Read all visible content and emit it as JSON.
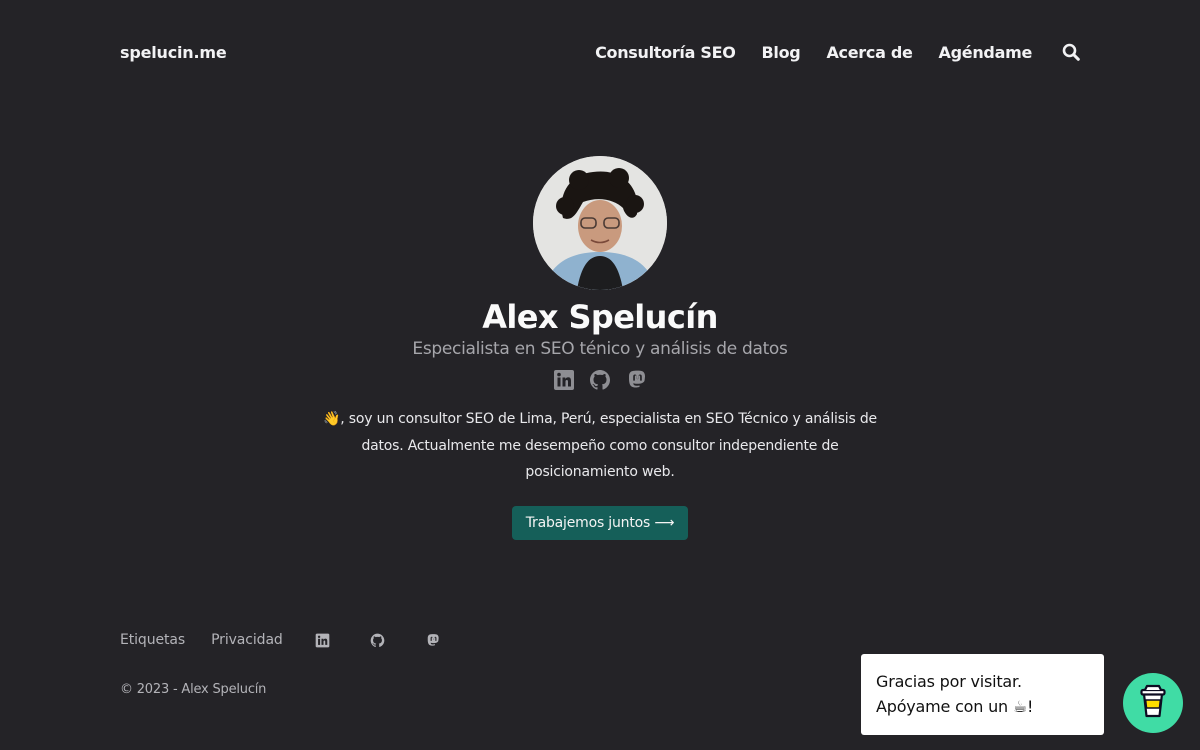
{
  "header": {
    "brand": "spelucin.me",
    "nav": [
      "Consultoría SEO",
      "Blog",
      "Acerca de",
      "Agéndame"
    ],
    "search_icon": "search-icon"
  },
  "profile": {
    "name": "Alex Spelucín",
    "tagline": "Especialista en SEO ténico y análisis de datos",
    "social_icons": [
      "linkedin-icon",
      "github-icon",
      "mastodon-icon"
    ],
    "bio": "👋, soy un consultor SEO de Lima, Perú, especialista en SEO Técnico y análisis de datos. Actualmente me desempeño como consultor independiente de posicionamiento web.",
    "cta_label": "Trabajemos juntos ⟶"
  },
  "footer": {
    "links": [
      "Etiquetas",
      "Privacidad"
    ],
    "social_icons": [
      "linkedin-icon",
      "github-icon",
      "mastodon-icon"
    ],
    "copyright": "© 2023 - Alex Spelucín"
  },
  "bmc": {
    "line1": "Gracias por visitar.",
    "line2": "Apóyame con un ☕!",
    "icon": "coffee-cup-icon"
  },
  "colors": {
    "background": "#242327",
    "cta": "#155f59",
    "bmc_button": "#40dca5"
  }
}
